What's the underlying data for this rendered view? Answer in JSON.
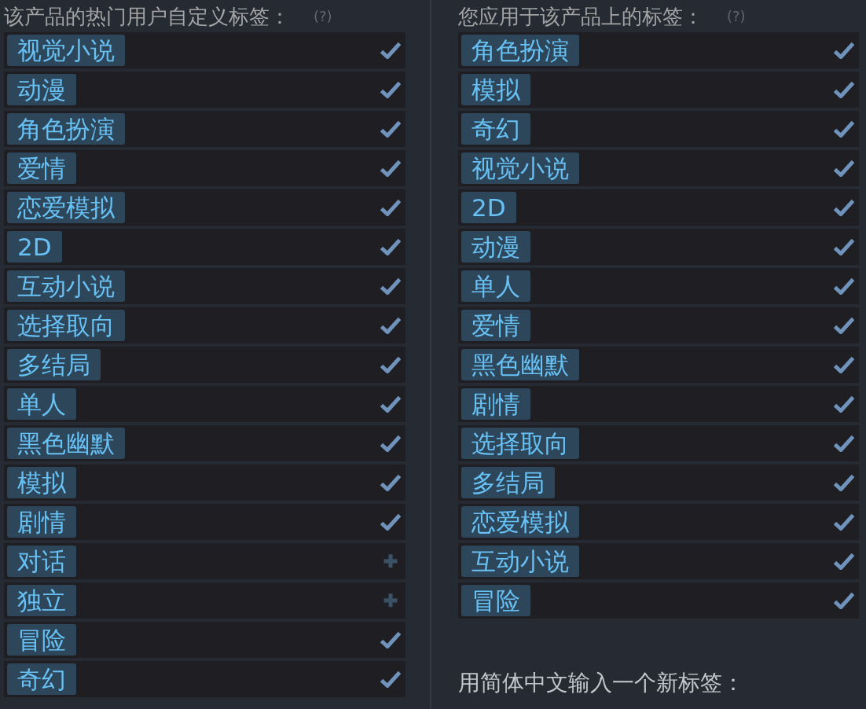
{
  "popular_tags": {
    "title": "该产品的热门用户自定义标签：",
    "help": "(?)",
    "tags": [
      {
        "label": "视觉小说",
        "applied": true
      },
      {
        "label": "动漫",
        "applied": true
      },
      {
        "label": "角色扮演",
        "applied": true
      },
      {
        "label": "爱情",
        "applied": true
      },
      {
        "label": "恋爱模拟",
        "applied": true
      },
      {
        "label": "2D",
        "applied": true
      },
      {
        "label": "互动小说",
        "applied": true
      },
      {
        "label": "选择取向",
        "applied": true
      },
      {
        "label": "多结局",
        "applied": true
      },
      {
        "label": "单人",
        "applied": true
      },
      {
        "label": "黑色幽默",
        "applied": true
      },
      {
        "label": "模拟",
        "applied": true
      },
      {
        "label": "剧情",
        "applied": true
      },
      {
        "label": "对话",
        "applied": false
      },
      {
        "label": "独立",
        "applied": false
      },
      {
        "label": "冒险",
        "applied": true
      },
      {
        "label": "奇幻",
        "applied": true
      }
    ]
  },
  "your_tags": {
    "title": "您应用于该产品上的标签：",
    "help": "(?)",
    "tags": [
      {
        "label": "角色扮演",
        "applied": true
      },
      {
        "label": "模拟",
        "applied": true
      },
      {
        "label": "奇幻",
        "applied": true
      },
      {
        "label": "视觉小说",
        "applied": true
      },
      {
        "label": "2D",
        "applied": true
      },
      {
        "label": "动漫",
        "applied": true
      },
      {
        "label": "单人",
        "applied": true
      },
      {
        "label": "爱情",
        "applied": true
      },
      {
        "label": "黑色幽默",
        "applied": true
      },
      {
        "label": "剧情",
        "applied": true
      },
      {
        "label": "选择取向",
        "applied": true
      },
      {
        "label": "多结局",
        "applied": true
      },
      {
        "label": "恋爱模拟",
        "applied": true
      },
      {
        "label": "互动小说",
        "applied": true
      },
      {
        "label": "冒险",
        "applied": true
      }
    ]
  },
  "new_tag_prompt": "用简体中文输入一个新标签："
}
